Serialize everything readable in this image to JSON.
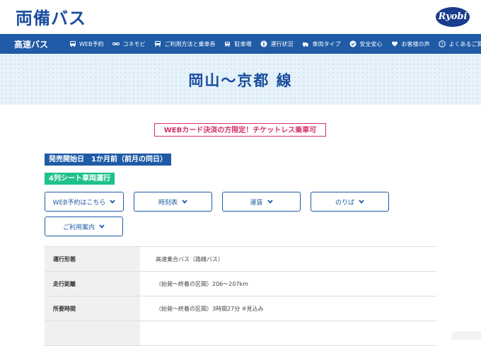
{
  "brand": {
    "logo_text": "両備バス",
    "corner_logo": "Ryobi"
  },
  "nav": {
    "brand_label": "高速バス",
    "items": [
      {
        "label": "WEB予約",
        "icon": "bus-icon"
      },
      {
        "label": "コネモビ",
        "icon": "link-icon"
      },
      {
        "label": "ご利用方法と乗車券",
        "icon": "ticket-icon"
      },
      {
        "label": "駐車場",
        "icon": "parking-icon"
      },
      {
        "label": "運行状況",
        "icon": "info-icon"
      },
      {
        "label": "車両タイプ",
        "icon": "coach-icon"
      },
      {
        "label": "安全安心",
        "icon": "shield-icon"
      },
      {
        "label": "お客様の声",
        "icon": "heart-icon"
      },
      {
        "label": "よくあるご質問",
        "icon": "question-icon"
      }
    ]
  },
  "hero": {
    "title": "岡山〜京都 線"
  },
  "notice": "WEBカード決済の方限定！チケットレス乗車可",
  "badges": {
    "sale_start": "発売開始日　1か月前（前月の同日）",
    "seat_type": "4列シート車両運行"
  },
  "buttons": {
    "web_reservation": "WEB予約はこちら",
    "timetable": "時刻表",
    "fare": "運賃",
    "bus_stop": "のりば",
    "guide": "ご利用案内"
  },
  "table": {
    "rows": [
      {
        "label": "運行形態",
        "value": "高速乗合バス（路線バス）"
      },
      {
        "label": "走行距離",
        "value": "（始発～終着の区間）206～207km"
      },
      {
        "label": "所要時間",
        "value": "（始発～終着の区間）3時間27分 ※見込み"
      },
      {
        "label": "",
        "value": ""
      }
    ]
  },
  "colors": {
    "primary": "#1f5ba6",
    "accent": "#d62f6b",
    "green": "#1fc28b",
    "hero_bg": "#e6f2fa"
  }
}
